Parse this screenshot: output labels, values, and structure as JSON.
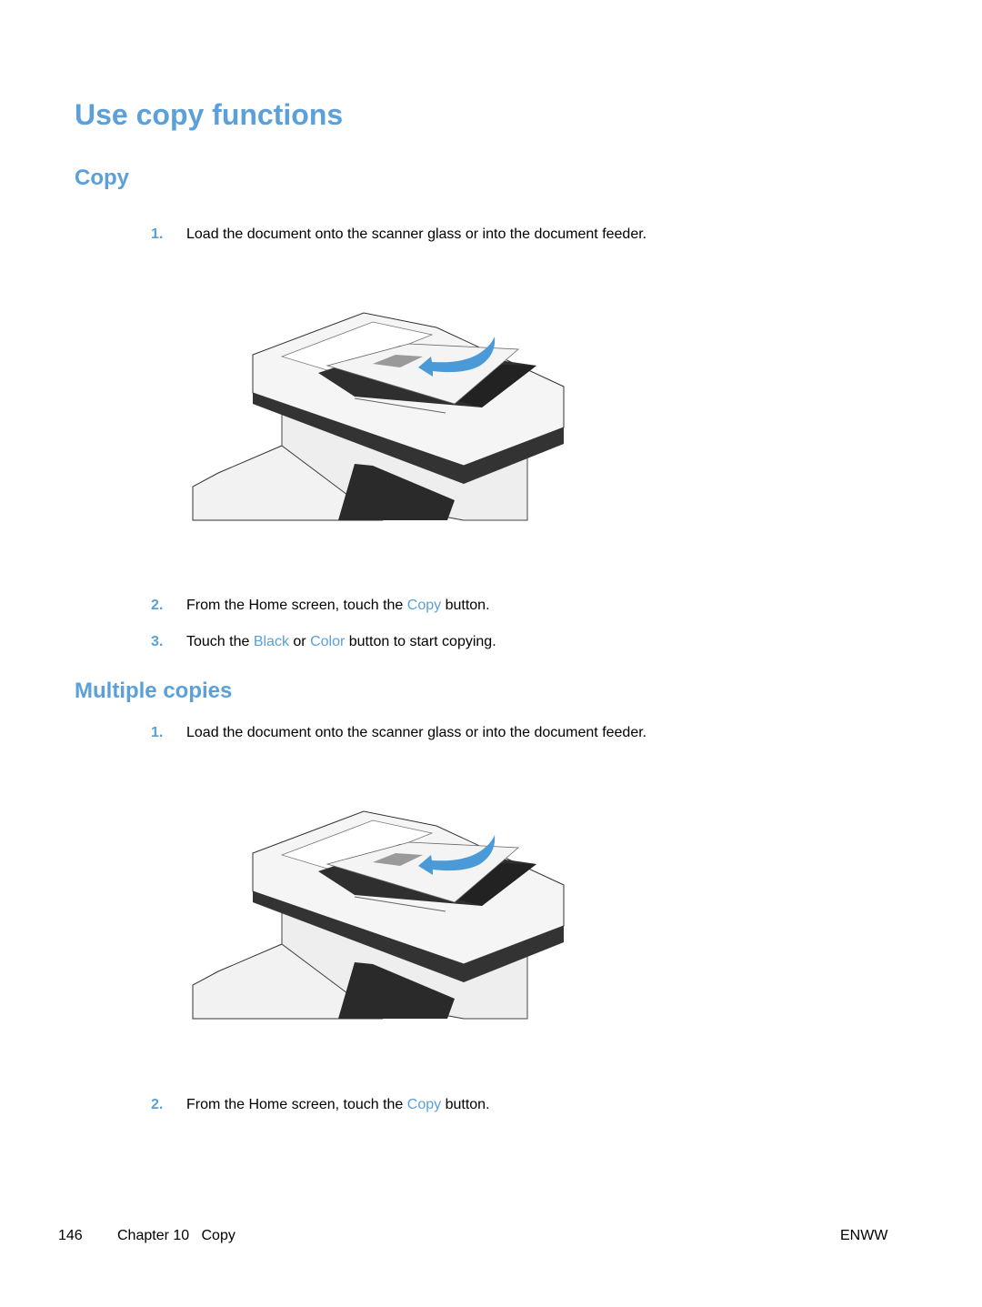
{
  "page": {
    "title": "Use copy functions",
    "sections": [
      {
        "heading": "Copy",
        "steps": [
          {
            "num": "1.",
            "text": "Load the document onto the scanner glass or into the document feeder."
          },
          {
            "num": "2.",
            "parts": [
              "From the Home screen, touch the ",
              "Copy",
              " button."
            ]
          },
          {
            "num": "3.",
            "parts": [
              "Touch the ",
              "Black",
              " or ",
              "Color",
              " button to start copying."
            ]
          }
        ],
        "figure_alt": "Document loaded into the printer's document feeder"
      },
      {
        "heading": "Multiple copies",
        "steps": [
          {
            "num": "1.",
            "text": "Load the document onto the scanner glass or into the document feeder."
          },
          {
            "num": "2.",
            "parts": [
              "From the Home screen, touch the ",
              "Copy",
              " button."
            ]
          }
        ],
        "figure_alt": "Document loaded into the printer's document feeder"
      }
    ]
  },
  "footer": {
    "page_number": "146",
    "chapter": "Chapter 10   Copy",
    "locale": "ENWW"
  },
  "colors": {
    "accent": "#5ba0d8",
    "text": "#000000"
  }
}
